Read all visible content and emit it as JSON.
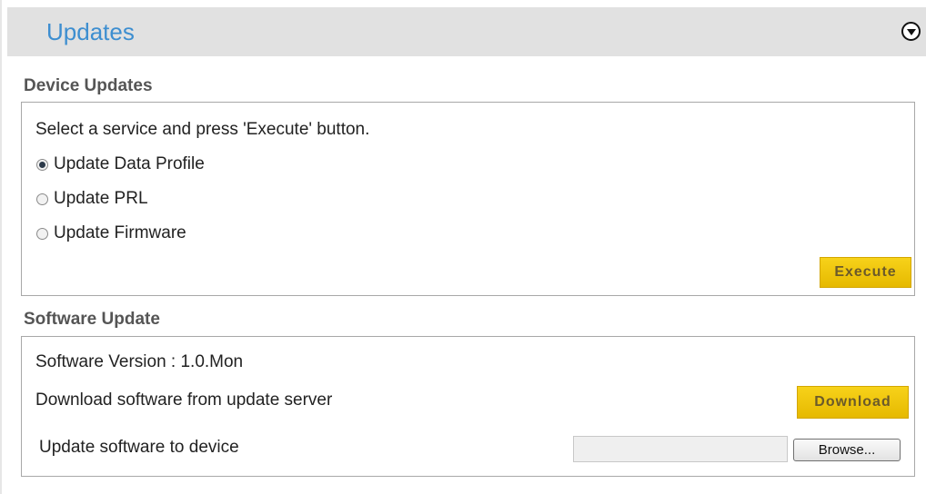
{
  "header": {
    "title": "Updates",
    "toggle_icon": "chevron-down-circle-icon"
  },
  "device_updates": {
    "title": "Device Updates",
    "instruction": "Select a service and press 'Execute' button.",
    "options": [
      {
        "label": "Update Data Profile",
        "checked": true
      },
      {
        "label": "Update PRL",
        "checked": false
      },
      {
        "label": "Update Firmware",
        "checked": false
      }
    ],
    "execute_label": "Execute"
  },
  "software_update": {
    "title": "Software Update",
    "version_text": "Software Version : 1.0.Mon",
    "download_text": "Download software from update server",
    "download_label": "Download",
    "update_text": "Update software to device",
    "file_value": "",
    "browse_label": "Browse..."
  },
  "colors": {
    "accent": "#3d8ed0",
    "button_yellow": "#f2c80a",
    "header_bg": "#e1e1e1"
  }
}
